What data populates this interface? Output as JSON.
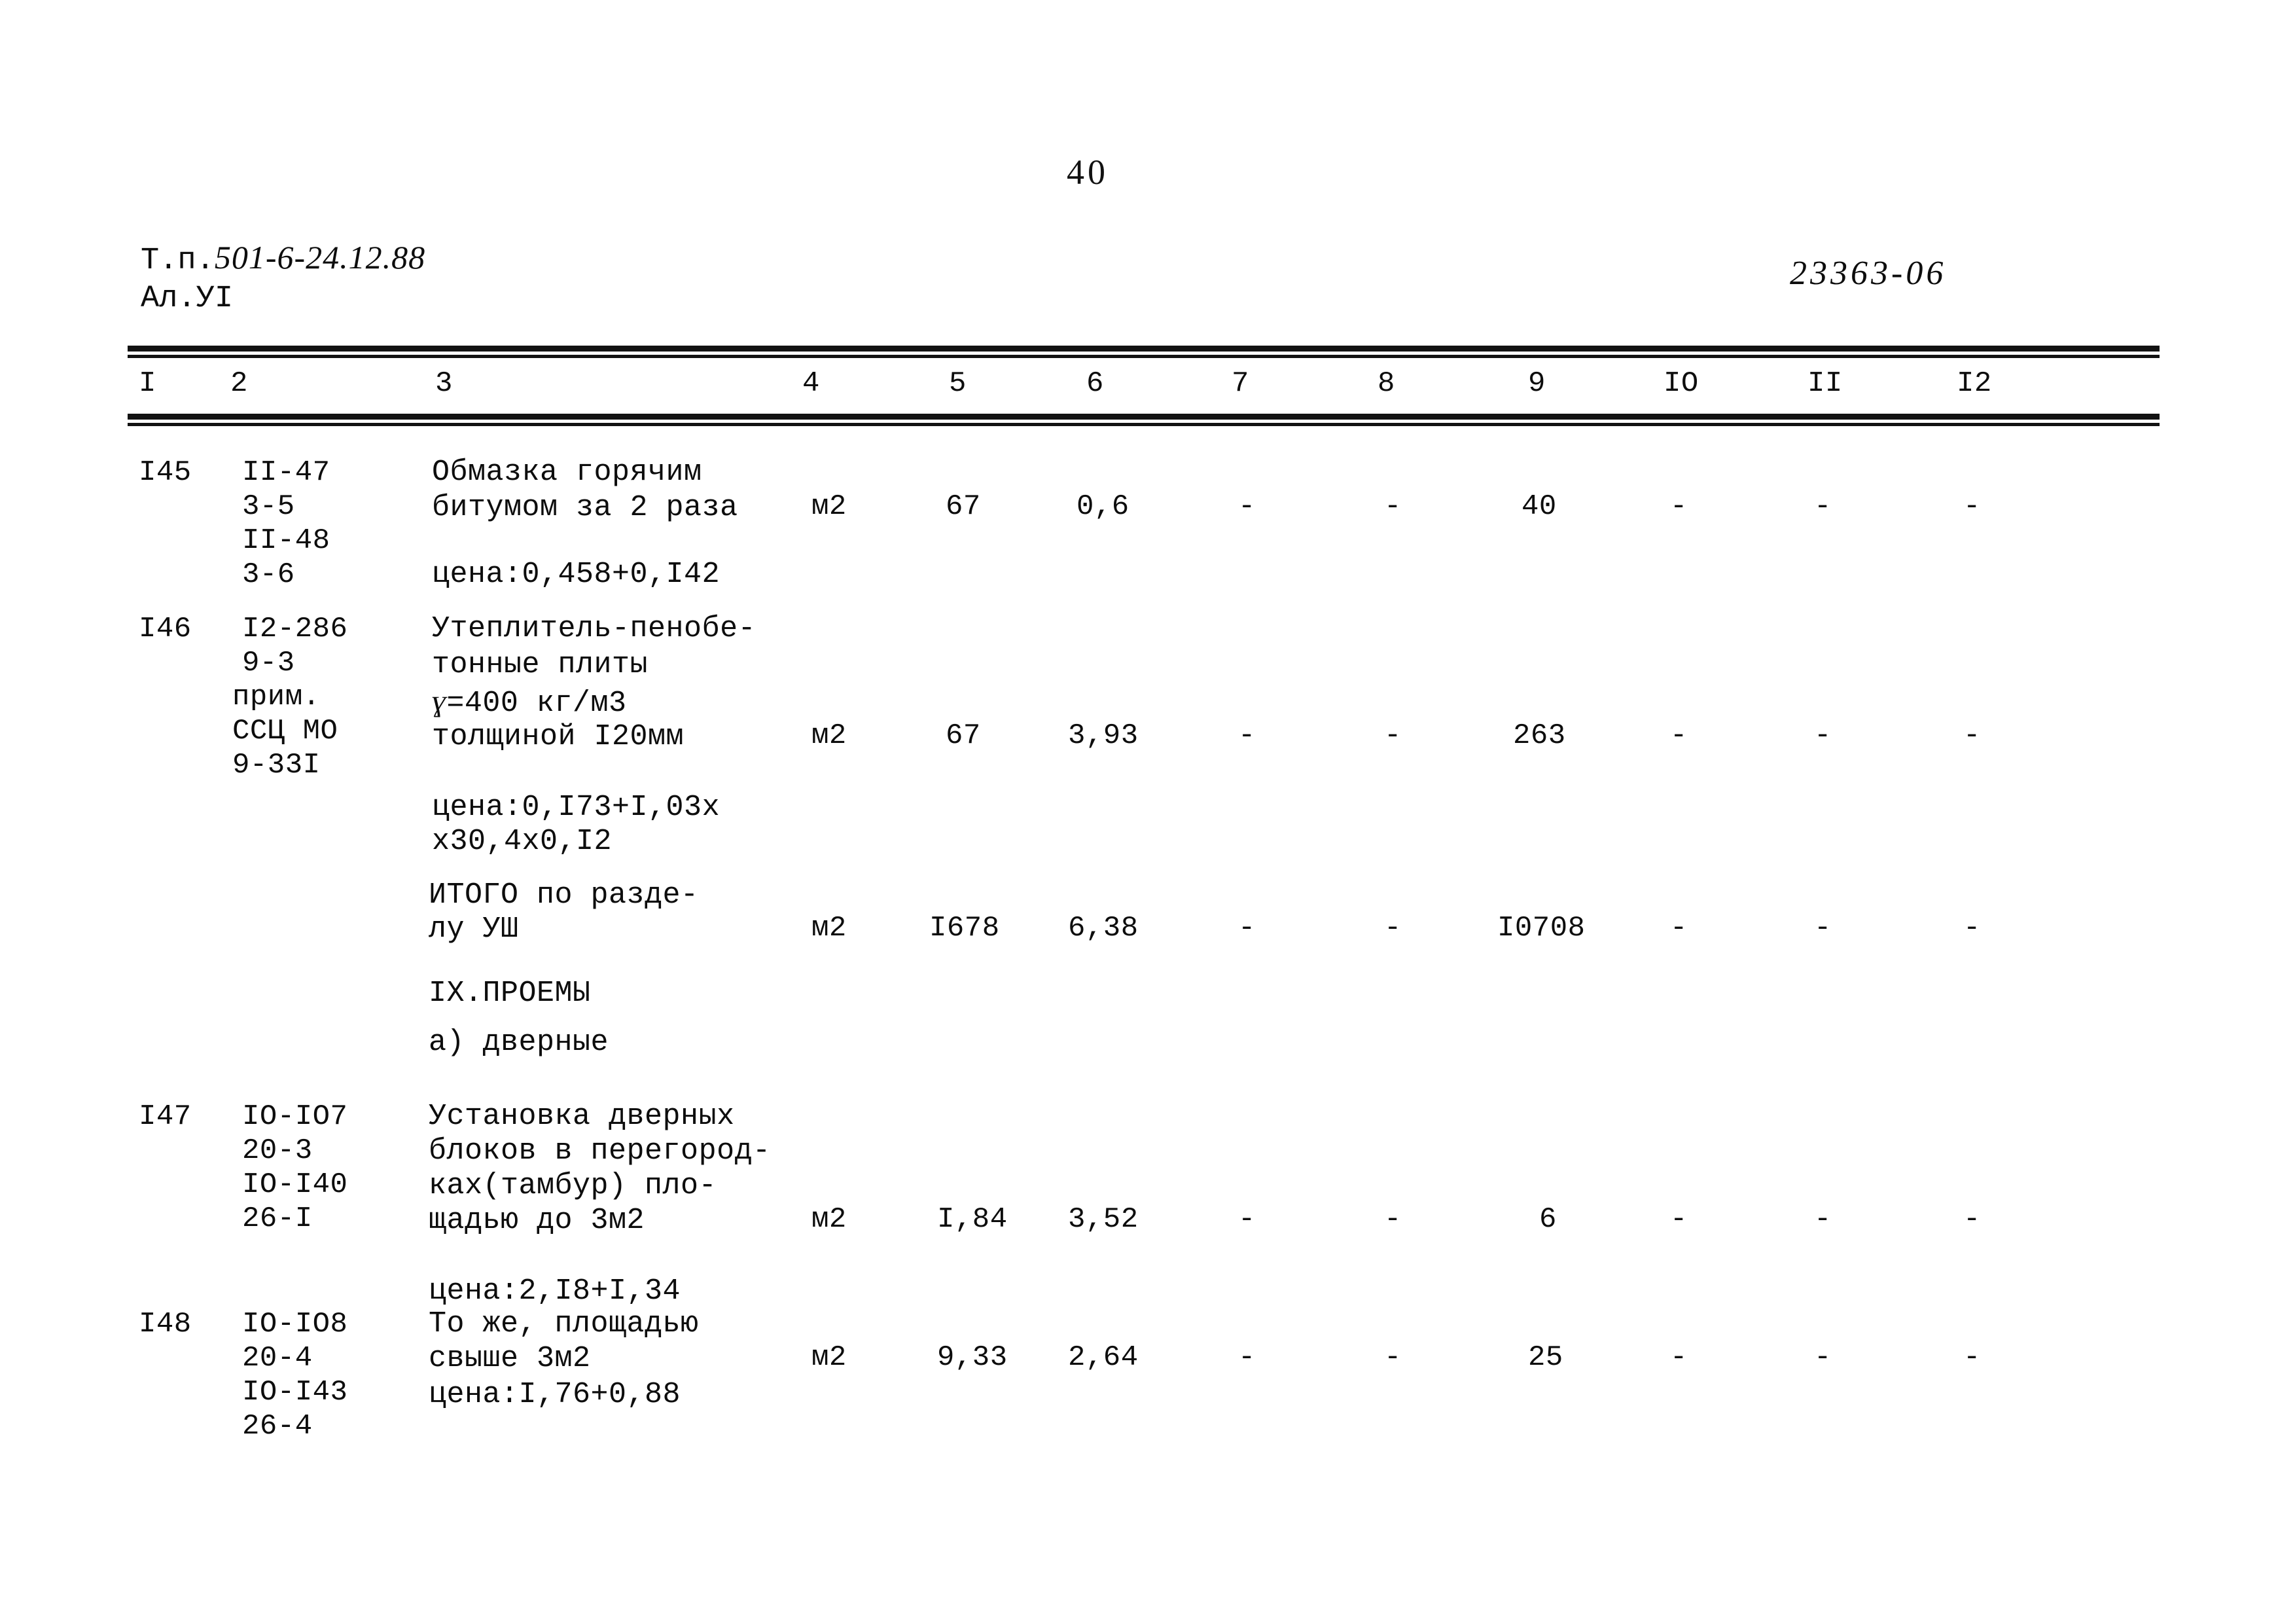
{
  "page": {
    "number": "40",
    "doc_prefix_line1": "Т.п.",
    "doc_code_line1": "501-6-24.12.88",
    "doc_line2": "Ал.УI",
    "archive_code": "23363-06"
  },
  "table": {
    "column_headers": [
      "I",
      "2",
      "3",
      "4",
      "5",
      "6",
      "7",
      "8",
      "9",
      "IO",
      "II",
      "I2"
    ],
    "dash": "-",
    "rows": [
      {
        "no": "I45",
        "code_lines": [
          "II-47",
          "3-5",
          "II-48",
          "3-6"
        ],
        "desc_lines": [
          "Обмазка горячим",
          "битумом за 2 раза"
        ],
        "price_line": "цена:0,458+0,I42",
        "unit": "м2",
        "c5": "67",
        "c6": "0,6",
        "c7": "-",
        "c8": "-",
        "c9": "40",
        "c10": "-",
        "c11": "-",
        "c12": "-"
      },
      {
        "no": "I46",
        "code_lines": [
          "I2-286",
          "9-3",
          "прим.",
          "ССЦ МО",
          "9-33I"
        ],
        "desc_lines": [
          "Утеплитель-пенобе-",
          "тонные плиты",
          "=400 кг/м3",
          "толщиной I20мм"
        ],
        "gamma_symbol": "ɣ",
        "price_line_1": "цена:0,I73+I,03х",
        "price_line_2": "х30,4х0,I2",
        "unit": "м2",
        "c5": "67",
        "c6": "3,93",
        "c7": "-",
        "c8": "-",
        "c9": "263",
        "c10": "-",
        "c11": "-",
        "c12": "-"
      }
    ],
    "total_row": {
      "desc_lines": [
        "ИТОГО по разде-",
        "лу УШ"
      ],
      "unit": "м2",
      "c5": "I678",
      "c6": "6,38",
      "c7": "-",
      "c8": "-",
      "c9": "I0708",
      "c10": "-",
      "c11": "-",
      "c12": "-"
    },
    "section": {
      "heading": "IX.ПРОЕМЫ",
      "subheading": "а) дверные"
    },
    "rows_after": [
      {
        "no": "I47",
        "code_lines": [
          "IO-IO7",
          "20-3",
          "IO-I40",
          "26-I"
        ],
        "desc_lines": [
          "Установка дверных",
          "блоков в перегород-",
          "ках(тамбур) пло-",
          "щадью до 3м2"
        ],
        "price_line": "цена:2,I8+I,34",
        "unit": "м2",
        "c5": "I,84",
        "c6": "3,52",
        "c7": "-",
        "c8": "-",
        "c9": "6",
        "c10": "-",
        "c11": "-",
        "c12": "-"
      },
      {
        "no": "I48",
        "code_lines": [
          "IO-IO8",
          "20-4",
          "IO-I43",
          "26-4"
        ],
        "desc_lines": [
          "То же, площадью",
          "свыше 3м2"
        ],
        "price_line": "цена:I,76+0,88",
        "unit": "м2",
        "c5": "9,33",
        "c6": "2,64",
        "c7": "-",
        "c8": "-",
        "c9": "25",
        "c10": "-",
        "c11": "-",
        "c12": "-"
      }
    ]
  }
}
